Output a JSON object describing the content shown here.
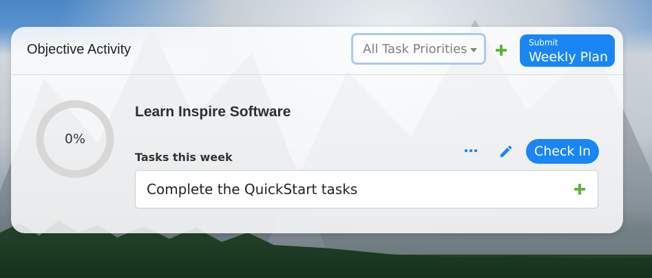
{
  "card": {
    "title": "Objective Activity",
    "priority_filter": {
      "selected": "All Task Priorities"
    },
    "submit": {
      "small_label": "Submit",
      "big_label": "Weekly Plan"
    }
  },
  "objective": {
    "progress_percent": 0,
    "progress_text": "0%",
    "title": "Learn Inspire Software",
    "tasks_label": "Tasks this week",
    "checkin_label": "Check In",
    "task_value": "Complete the QuickStart tasks"
  },
  "icons": {
    "add_priority": "plus-icon",
    "add_task": "plus-icon",
    "more": "more-icon",
    "edit": "pencil-icon",
    "priority_caret": "chevron-down-icon"
  },
  "colors": {
    "accent_blue": "#1a86f5",
    "plus_green": "#5db33a",
    "ring_gray": "#d7d7d7"
  }
}
